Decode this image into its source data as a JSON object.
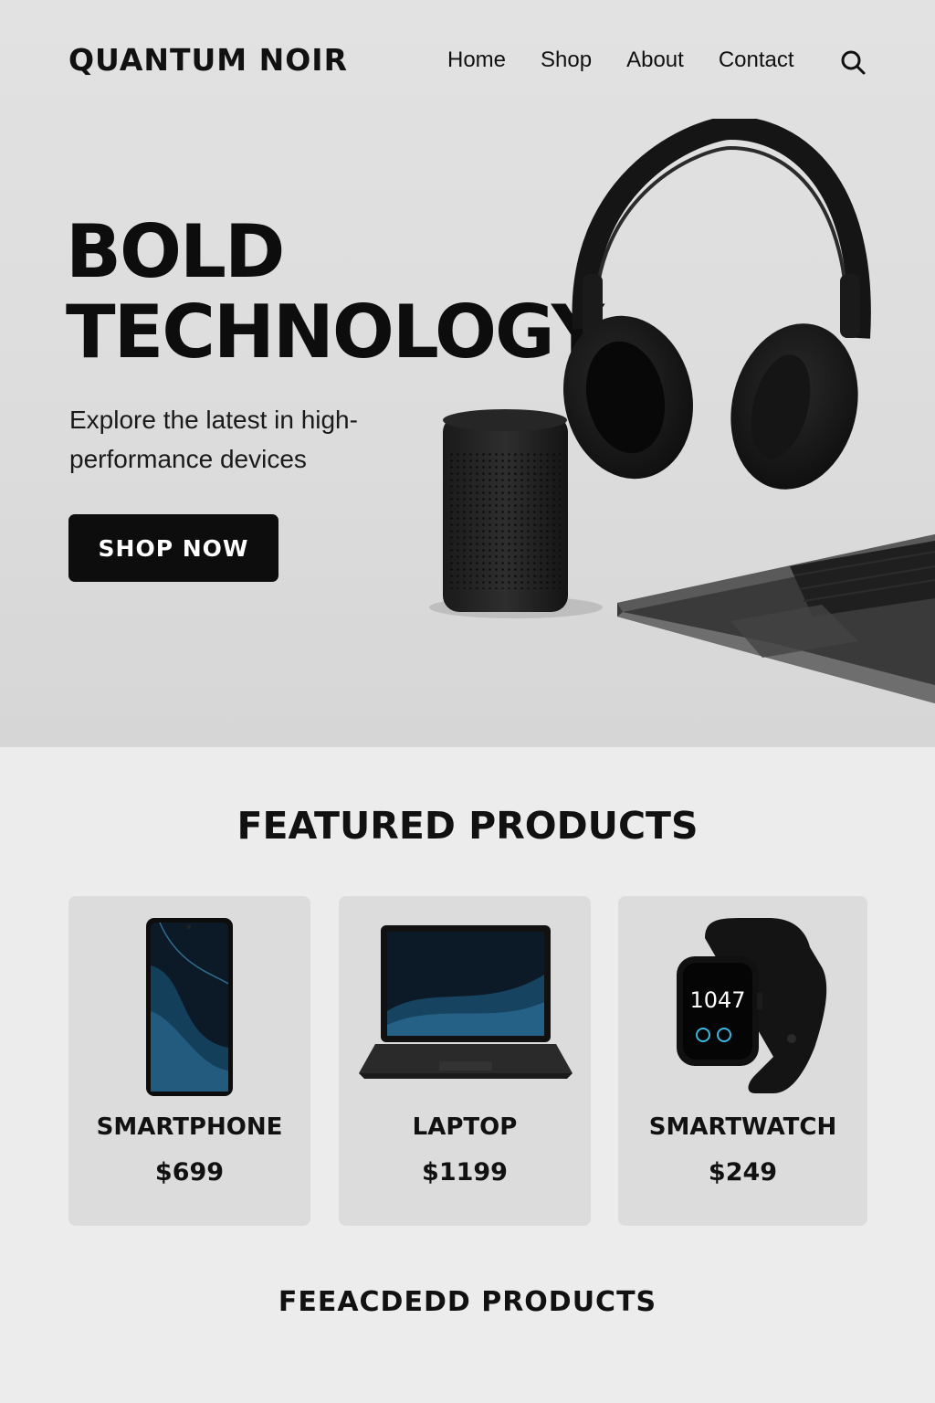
{
  "brand": {
    "name": "QUANTUM NOIR"
  },
  "nav": {
    "items": [
      {
        "label": "Home"
      },
      {
        "label": "Shop"
      },
      {
        "label": "About"
      },
      {
        "label": "Contact"
      }
    ],
    "search_icon": "search-icon"
  },
  "hero": {
    "title_line1": "BOLD",
    "title_line2": "TECHNOLOGY",
    "subtitle": "Explore the latest in high-performance devices",
    "cta_label": "SHOP NOW",
    "products_shown": [
      "headphones",
      "speaker",
      "laptop"
    ]
  },
  "featured": {
    "title": "FEATURED PRODUCTS",
    "products": [
      {
        "name": "SMARTPHONE",
        "price": "$699",
        "image": "smartphone-image"
      },
      {
        "name": "LAPTOP",
        "price": "$1199",
        "image": "laptop-image"
      },
      {
        "name": "SMARTWATCH",
        "price": "$249",
        "image": "smartwatch-image",
        "watch_time": "1047"
      }
    ]
  },
  "footer": {
    "title": "FEEACDEDD PRODUCTS"
  },
  "colors": {
    "accent": "#0d0d0d",
    "hero_bg": "#dcdcdc",
    "page_bg": "#ececec",
    "card_bg": "#dcdcdc",
    "screen_blue": "#1e5f86"
  }
}
